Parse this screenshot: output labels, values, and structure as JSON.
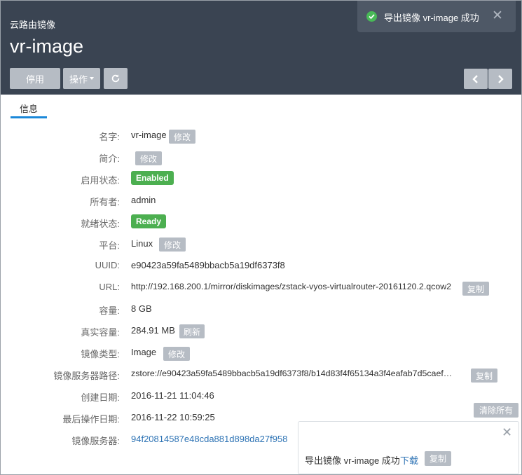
{
  "header": {
    "subtitle": "云路由镜像",
    "title": "vr-image",
    "buttons": {
      "stop": "停用",
      "actions": "操作"
    }
  },
  "toast": {
    "message": "导出镜像 vr-image 成功"
  },
  "tabs": [
    {
      "label": "信息"
    }
  ],
  "details": {
    "name": {
      "label": "名字:",
      "value": "vr-image",
      "action": "修改"
    },
    "description": {
      "label": "简介:",
      "value": "",
      "action": "修改"
    },
    "enable_state": {
      "label": "启用状态:",
      "value": "Enabled"
    },
    "owner": {
      "label": "所有者:",
      "value": "admin"
    },
    "ready_state": {
      "label": "就绪状态:",
      "value": "Ready"
    },
    "platform": {
      "label": "平台:",
      "value": "Linux",
      "action": "修改"
    },
    "uuid": {
      "label": "UUID:",
      "value": "e90423a59fa5489bbacb5a19df6373f8"
    },
    "url": {
      "label": "URL:",
      "value": "http://192.168.200.1/mirror/diskimages/zstack-vyos-virtualrouter-20161120.2.qcow2",
      "action": "复制"
    },
    "size": {
      "label": "容量:",
      "value": "8 GB"
    },
    "actual_size": {
      "label": "真实容量:",
      "value": "284.91 MB",
      "action": "刷新"
    },
    "image_type": {
      "label": "镜像类型:",
      "value": "Image",
      "action": "修改"
    },
    "backup_path": {
      "label": "镜像服务器路径:",
      "value": "zstore://e90423a59fa5489bbacb5a19df6373f8/b14d83f4f65134a3f4eafab7d5caef…",
      "action": "复制"
    },
    "created": {
      "label": "创建日期:",
      "value": "2016-11-21 11:04:46"
    },
    "last_op": {
      "label": "最后操作日期:",
      "value": "2016-11-22 10:59:25"
    },
    "backup_storage": {
      "label": "镜像服务器:",
      "value": "94f20814587e48cda881d898da27f958"
    }
  },
  "notifications": {
    "clear_all": "清除所有",
    "item": {
      "message": "导出镜像 vr-image 成功",
      "download": "下载",
      "copy": "复制"
    }
  },
  "colors": {
    "header_bg": "#3a4452",
    "accent": "#1b88d9",
    "success": "#4caf50",
    "button": "#b6bcc4"
  }
}
